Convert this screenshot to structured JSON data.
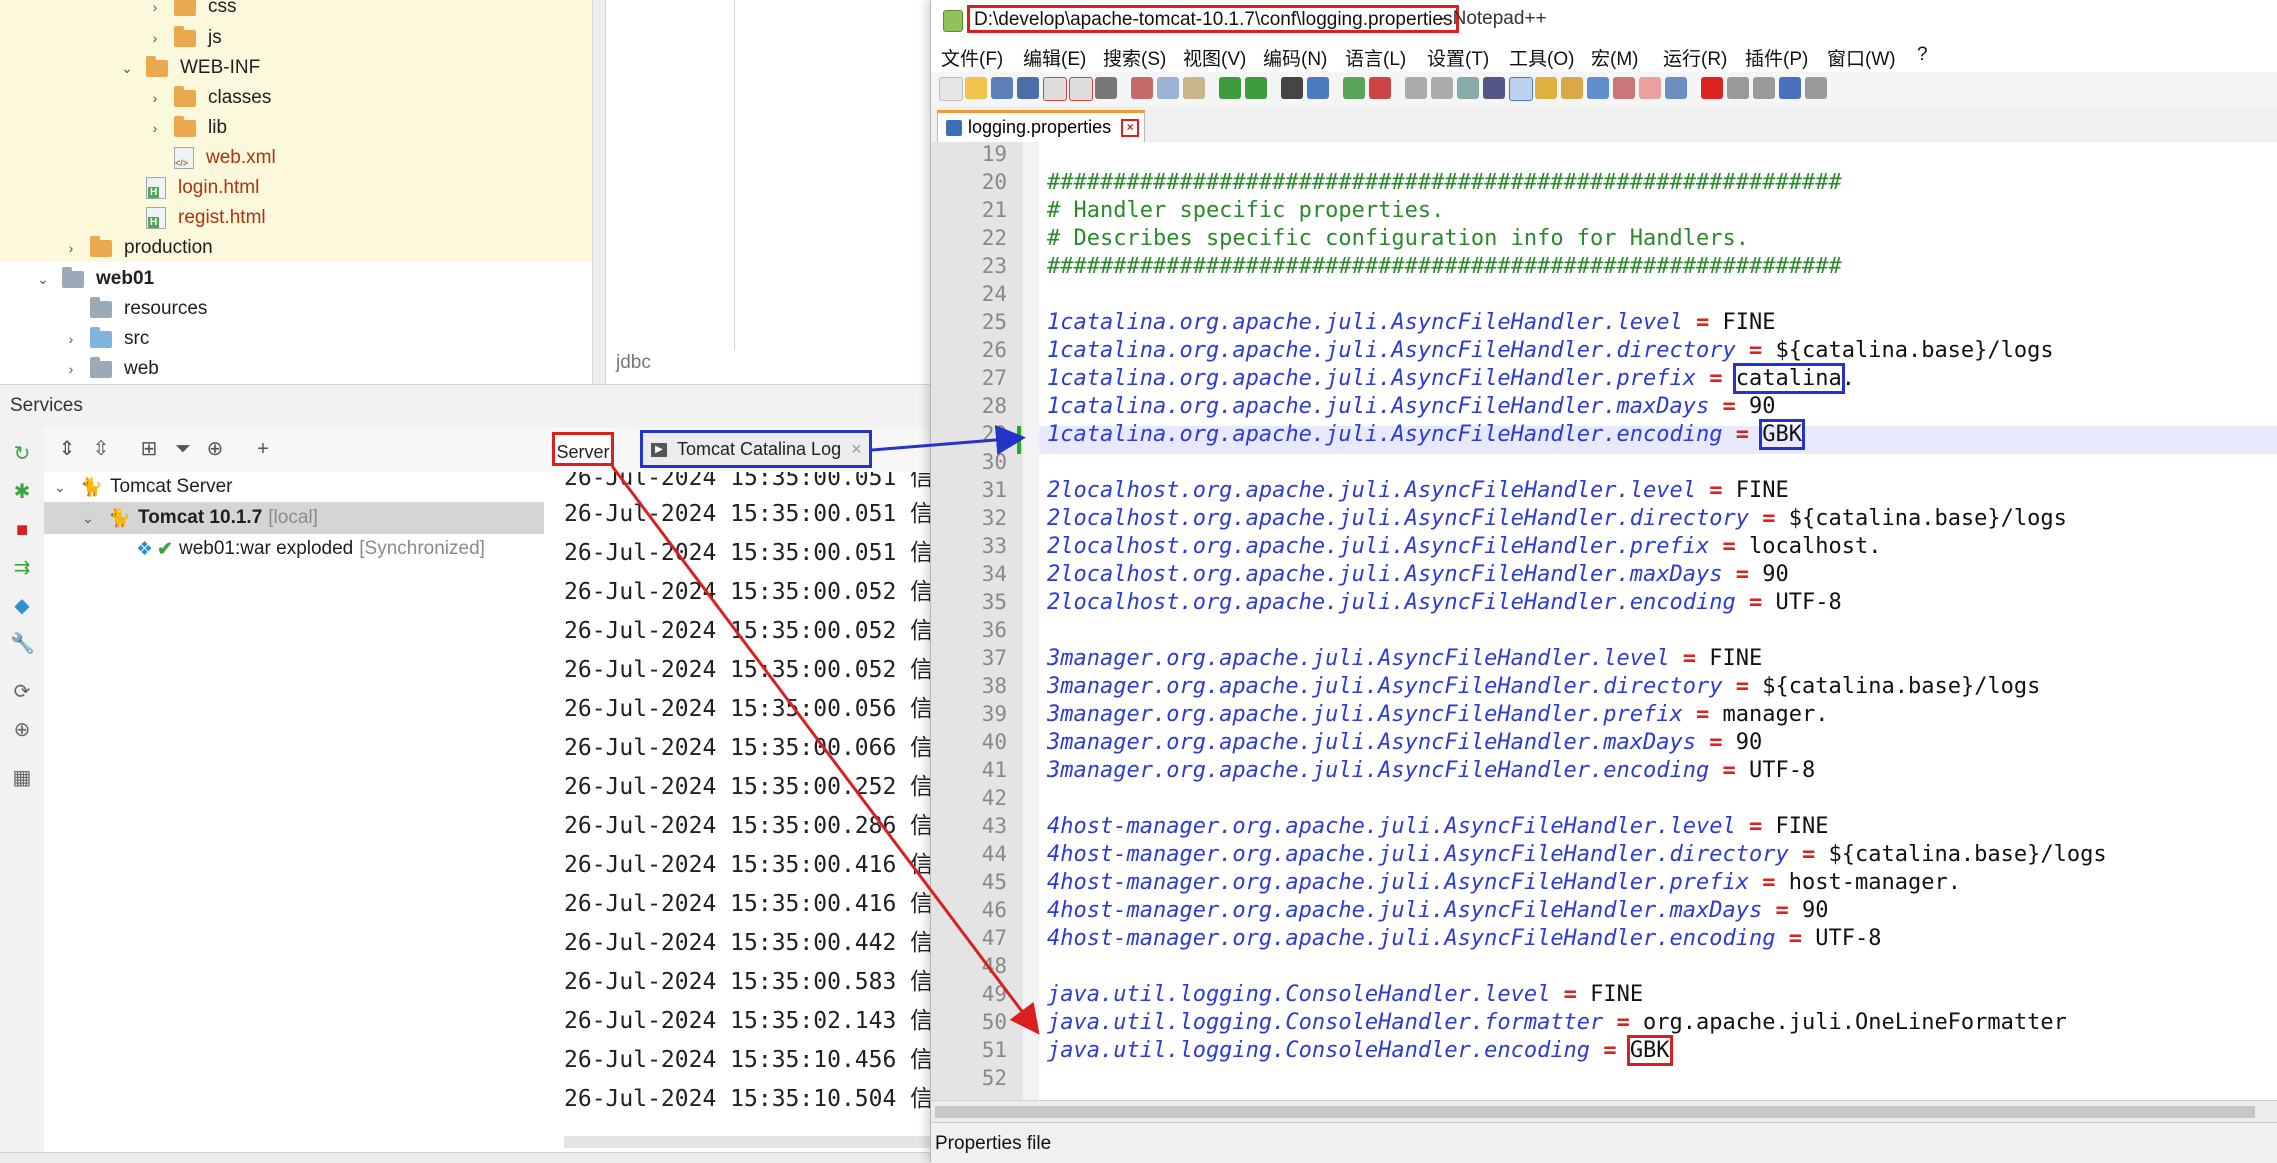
{
  "project_tree": {
    "items": [
      {
        "label": "css"
      },
      {
        "label": "js"
      },
      {
        "label": "WEB-INF"
      },
      {
        "label": "classes"
      },
      {
        "label": "lib"
      },
      {
        "label": "web.xml"
      },
      {
        "label": "login.html"
      },
      {
        "label": "regist.html"
      },
      {
        "label": "production"
      },
      {
        "label": "web01"
      },
      {
        "label": "resources"
      },
      {
        "label": "src"
      },
      {
        "label": "web"
      }
    ]
  },
  "middle_pane": {
    "tab_label": "jdbc"
  },
  "services": {
    "title": "Services",
    "tree": {
      "root": "Tomcat Server",
      "server_name": "Tomcat 10.1.7",
      "server_tag": "[local]",
      "artifact": "web01:war exploded",
      "artifact_status": "[Synchronized]"
    },
    "tabs": {
      "server": "Server",
      "catalina_log": "Tomcat Catalina Log"
    },
    "log_lines": [
      "26-Jul-2024 15:35:00.051 信",
      "26-Jul-2024 15:35:00.051 信",
      "26-Jul-2024 15:35:00.051 信",
      "26-Jul-2024 15:35:00.052 信",
      "26-Jul-2024 15:35:00.052 信",
      "26-Jul-2024 15:35:00.052 信",
      "26-Jul-2024 15:35:00.056 信",
      "26-Jul-2024 15:35:00.066 信",
      "26-Jul-2024 15:35:00.252 信",
      "26-Jul-2024 15:35:00.286 信",
      "26-Jul-2024 15:35:00.416 信",
      "26-Jul-2024 15:35:00.416 信",
      "26-Jul-2024 15:35:00.442 信",
      "26-Jul-2024 15:35:00.583 信",
      "26-Jul-2024 15:35:02.143 信",
      "26-Jul-2024 15:35:10.456 信",
      "26-Jul-2024 15:35:10.504 信"
    ]
  },
  "notepad": {
    "title_path": "D:\\develop\\apache-tomcat-10.1.7\\conf\\logging.properties",
    "title_suffix": "- Notepad++",
    "menu": [
      "文件(F)",
      "编辑(E)",
      "搜索(S)",
      "视图(V)",
      "编码(N)",
      "语言(L)",
      "设置(T)",
      "工具(O)",
      "宏(M)",
      "运行(R)",
      "插件(P)",
      "窗口(W)",
      "?"
    ],
    "tab_label": "logging.properties",
    "status_text": "Properties file",
    "line_numbers": [
      "19",
      "20",
      "21",
      "22",
      "23",
      "24",
      "25",
      "26",
      "27",
      "28",
      "29",
      "30",
      "31",
      "32",
      "33",
      "34",
      "35",
      "36",
      "37",
      "38",
      "39",
      "40",
      "41",
      "42",
      "43",
      "44",
      "45",
      "46",
      "47",
      "48",
      "49",
      "50",
      "51",
      "52"
    ],
    "lines": {
      "l20": "############################################################",
      "l21": "# Handler specific properties.",
      "l22": "# Describes specific configuration info for Handlers.",
      "l23": "############################################################",
      "l25k": "1catalina.org.apache.juli.AsyncFileHandler.level",
      "l25v": "FINE",
      "l26k": "1catalina.org.apache.juli.AsyncFileHandler.directory",
      "l26v": "${catalina.base}/logs",
      "l27k": "1catalina.org.apache.juli.AsyncFileHandler.prefix",
      "l27v": "catalina",
      "l27t": ".",
      "l28k": "1catalina.org.apache.juli.AsyncFileHandler.maxDays",
      "l28v": "90",
      "l29k": "1catalina.org.apache.juli.AsyncFileHandler.encoding",
      "l29v": "GBK",
      "l31k": "2localhost.org.apache.juli.AsyncFileHandler.level",
      "l31v": "FINE",
      "l32k": "2localhost.org.apache.juli.AsyncFileHandler.directory",
      "l32v": "${catalina.base}/logs",
      "l33k": "2localhost.org.apache.juli.AsyncFileHandler.prefix",
      "l33v": "localhost.",
      "l34k": "2localhost.org.apache.juli.AsyncFileHandler.maxDays",
      "l34v": "90",
      "l35k": "2localhost.org.apache.juli.AsyncFileHandler.encoding",
      "l35v": "UTF-8",
      "l37k": "3manager.org.apache.juli.AsyncFileHandler.level",
      "l37v": "FINE",
      "l38k": "3manager.org.apache.juli.AsyncFileHandler.directory",
      "l38v": "${catalina.base}/logs",
      "l39k": "3manager.org.apache.juli.AsyncFileHandler.prefix",
      "l39v": "manager.",
      "l40k": "3manager.org.apache.juli.AsyncFileHandler.maxDays",
      "l40v": "90",
      "l41k": "3manager.org.apache.juli.AsyncFileHandler.encoding",
      "l41v": "UTF-8",
      "l43k": "4host-manager.org.apache.juli.AsyncFileHandler.level",
      "l43v": "FINE",
      "l44k": "4host-manager.org.apache.juli.AsyncFileHandler.directory",
      "l44v": "${catalina.base}/logs",
      "l45k": "4host-manager.org.apache.juli.AsyncFileHandler.prefix",
      "l45v": "host-manager.",
      "l46k": "4host-manager.org.apache.juli.AsyncFileHandler.maxDays",
      "l46v": "90",
      "l47k": "4host-manager.org.apache.juli.AsyncFileHandler.encoding",
      "l47v": "UTF-8",
      "l49k": "java.util.logging.ConsoleHandler.level",
      "l49v": "FINE",
      "l50k": "java.util.logging.ConsoleHandler.formatter",
      "l50v": "org.apache.juli.OneLineFormatter",
      "l51k": "java.util.logging.ConsoleHandler.encoding",
      "l51v": "GBK",
      "eq": "="
    }
  },
  "colors": {
    "annotation_red": "#d8211f",
    "annotation_blue": "#2434c8",
    "comment_green": "#2a8a2a",
    "key_blue": "#2b3bd6"
  }
}
